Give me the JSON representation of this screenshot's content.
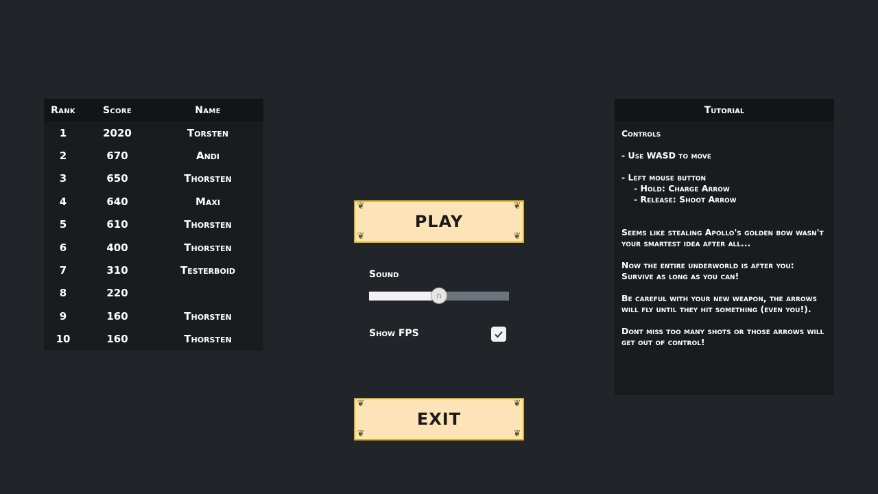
{
  "leaderboard": {
    "headers": {
      "rank": "Rank",
      "score": "Score",
      "name": "Name"
    },
    "rows": [
      {
        "rank": "1",
        "score": "2020",
        "name": "Torsten"
      },
      {
        "rank": "2",
        "score": "670",
        "name": "Andi"
      },
      {
        "rank": "3",
        "score": "650",
        "name": "Thorsten"
      },
      {
        "rank": "4",
        "score": "640",
        "name": "Maxi"
      },
      {
        "rank": "5",
        "score": "610",
        "name": "Thorsten"
      },
      {
        "rank": "6",
        "score": "400",
        "name": "Thorsten"
      },
      {
        "rank": "7",
        "score": "310",
        "name": "Testerboid"
      },
      {
        "rank": "8",
        "score": "220",
        "name": ""
      },
      {
        "rank": "9",
        "score": "160",
        "name": "Thorsten"
      },
      {
        "rank": "10",
        "score": "160",
        "name": "Thorsten"
      }
    ]
  },
  "menu": {
    "play_label": "PLAY",
    "exit_label": "EXIT",
    "sound_label": "Sound",
    "sound_level": 0.5,
    "show_fps_label": "Show FPS",
    "show_fps_checked": true
  },
  "tutorial": {
    "title": "Tutorial",
    "controls_heading": "Controls",
    "move_line": "- Use WASD to move",
    "mouse_line": "- Left mouse button",
    "hold_line": "- Hold: Charge Arrow",
    "release_line": "- Release: Shoot Arrow",
    "story_1": "Seems like stealing Apollo's golden bow wasn't your smartest idea after all...",
    "story_2": "Now the entire underworld is after you: Survive as long as you can!",
    "story_3": "Be careful with your new weapon, the arrows will fly until they hit something (even you!).",
    "story_4": "Dont miss too many shots or those arrows will get out of control!"
  },
  "colors": {
    "background": "#212529",
    "panel": "#191c1f",
    "panel_header": "#121416",
    "button_fill": "#fde4b8",
    "button_border": "#d9b326"
  }
}
